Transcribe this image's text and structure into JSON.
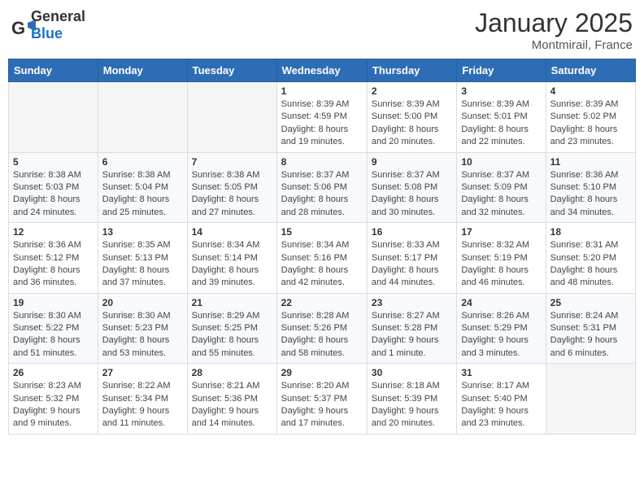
{
  "header": {
    "logo_general": "General",
    "logo_blue": "Blue",
    "month": "January 2025",
    "location": "Montmirail, France"
  },
  "weekdays": [
    "Sunday",
    "Monday",
    "Tuesday",
    "Wednesday",
    "Thursday",
    "Friday",
    "Saturday"
  ],
  "weeks": [
    [
      {
        "day": "",
        "info": ""
      },
      {
        "day": "",
        "info": ""
      },
      {
        "day": "",
        "info": ""
      },
      {
        "day": "1",
        "sunrise": "Sunrise: 8:39 AM",
        "sunset": "Sunset: 4:59 PM",
        "daylight": "Daylight: 8 hours and 19 minutes."
      },
      {
        "day": "2",
        "sunrise": "Sunrise: 8:39 AM",
        "sunset": "Sunset: 5:00 PM",
        "daylight": "Daylight: 8 hours and 20 minutes."
      },
      {
        "day": "3",
        "sunrise": "Sunrise: 8:39 AM",
        "sunset": "Sunset: 5:01 PM",
        "daylight": "Daylight: 8 hours and 22 minutes."
      },
      {
        "day": "4",
        "sunrise": "Sunrise: 8:39 AM",
        "sunset": "Sunset: 5:02 PM",
        "daylight": "Daylight: 8 hours and 23 minutes."
      }
    ],
    [
      {
        "day": "5",
        "sunrise": "Sunrise: 8:38 AM",
        "sunset": "Sunset: 5:03 PM",
        "daylight": "Daylight: 8 hours and 24 minutes."
      },
      {
        "day": "6",
        "sunrise": "Sunrise: 8:38 AM",
        "sunset": "Sunset: 5:04 PM",
        "daylight": "Daylight: 8 hours and 25 minutes."
      },
      {
        "day": "7",
        "sunrise": "Sunrise: 8:38 AM",
        "sunset": "Sunset: 5:05 PM",
        "daylight": "Daylight: 8 hours and 27 minutes."
      },
      {
        "day": "8",
        "sunrise": "Sunrise: 8:37 AM",
        "sunset": "Sunset: 5:06 PM",
        "daylight": "Daylight: 8 hours and 28 minutes."
      },
      {
        "day": "9",
        "sunrise": "Sunrise: 8:37 AM",
        "sunset": "Sunset: 5:08 PM",
        "daylight": "Daylight: 8 hours and 30 minutes."
      },
      {
        "day": "10",
        "sunrise": "Sunrise: 8:37 AM",
        "sunset": "Sunset: 5:09 PM",
        "daylight": "Daylight: 8 hours and 32 minutes."
      },
      {
        "day": "11",
        "sunrise": "Sunrise: 8:36 AM",
        "sunset": "Sunset: 5:10 PM",
        "daylight": "Daylight: 8 hours and 34 minutes."
      }
    ],
    [
      {
        "day": "12",
        "sunrise": "Sunrise: 8:36 AM",
        "sunset": "Sunset: 5:12 PM",
        "daylight": "Daylight: 8 hours and 36 minutes."
      },
      {
        "day": "13",
        "sunrise": "Sunrise: 8:35 AM",
        "sunset": "Sunset: 5:13 PM",
        "daylight": "Daylight: 8 hours and 37 minutes."
      },
      {
        "day": "14",
        "sunrise": "Sunrise: 8:34 AM",
        "sunset": "Sunset: 5:14 PM",
        "daylight": "Daylight: 8 hours and 39 minutes."
      },
      {
        "day": "15",
        "sunrise": "Sunrise: 8:34 AM",
        "sunset": "Sunset: 5:16 PM",
        "daylight": "Daylight: 8 hours and 42 minutes."
      },
      {
        "day": "16",
        "sunrise": "Sunrise: 8:33 AM",
        "sunset": "Sunset: 5:17 PM",
        "daylight": "Daylight: 8 hours and 44 minutes."
      },
      {
        "day": "17",
        "sunrise": "Sunrise: 8:32 AM",
        "sunset": "Sunset: 5:19 PM",
        "daylight": "Daylight: 8 hours and 46 minutes."
      },
      {
        "day": "18",
        "sunrise": "Sunrise: 8:31 AM",
        "sunset": "Sunset: 5:20 PM",
        "daylight": "Daylight: 8 hours and 48 minutes."
      }
    ],
    [
      {
        "day": "19",
        "sunrise": "Sunrise: 8:30 AM",
        "sunset": "Sunset: 5:22 PM",
        "daylight": "Daylight: 8 hours and 51 minutes."
      },
      {
        "day": "20",
        "sunrise": "Sunrise: 8:30 AM",
        "sunset": "Sunset: 5:23 PM",
        "daylight": "Daylight: 8 hours and 53 minutes."
      },
      {
        "day": "21",
        "sunrise": "Sunrise: 8:29 AM",
        "sunset": "Sunset: 5:25 PM",
        "daylight": "Daylight: 8 hours and 55 minutes."
      },
      {
        "day": "22",
        "sunrise": "Sunrise: 8:28 AM",
        "sunset": "Sunset: 5:26 PM",
        "daylight": "Daylight: 8 hours and 58 minutes."
      },
      {
        "day": "23",
        "sunrise": "Sunrise: 8:27 AM",
        "sunset": "Sunset: 5:28 PM",
        "daylight": "Daylight: 9 hours and 1 minute."
      },
      {
        "day": "24",
        "sunrise": "Sunrise: 8:26 AM",
        "sunset": "Sunset: 5:29 PM",
        "daylight": "Daylight: 9 hours and 3 minutes."
      },
      {
        "day": "25",
        "sunrise": "Sunrise: 8:24 AM",
        "sunset": "Sunset: 5:31 PM",
        "daylight": "Daylight: 9 hours and 6 minutes."
      }
    ],
    [
      {
        "day": "26",
        "sunrise": "Sunrise: 8:23 AM",
        "sunset": "Sunset: 5:32 PM",
        "daylight": "Daylight: 9 hours and 9 minutes."
      },
      {
        "day": "27",
        "sunrise": "Sunrise: 8:22 AM",
        "sunset": "Sunset: 5:34 PM",
        "daylight": "Daylight: 9 hours and 11 minutes."
      },
      {
        "day": "28",
        "sunrise": "Sunrise: 8:21 AM",
        "sunset": "Sunset: 5:36 PM",
        "daylight": "Daylight: 9 hours and 14 minutes."
      },
      {
        "day": "29",
        "sunrise": "Sunrise: 8:20 AM",
        "sunset": "Sunset: 5:37 PM",
        "daylight": "Daylight: 9 hours and 17 minutes."
      },
      {
        "day": "30",
        "sunrise": "Sunrise: 8:18 AM",
        "sunset": "Sunset: 5:39 PM",
        "daylight": "Daylight: 9 hours and 20 minutes."
      },
      {
        "day": "31",
        "sunrise": "Sunrise: 8:17 AM",
        "sunset": "Sunset: 5:40 PM",
        "daylight": "Daylight: 9 hours and 23 minutes."
      },
      {
        "day": "",
        "info": ""
      }
    ]
  ]
}
